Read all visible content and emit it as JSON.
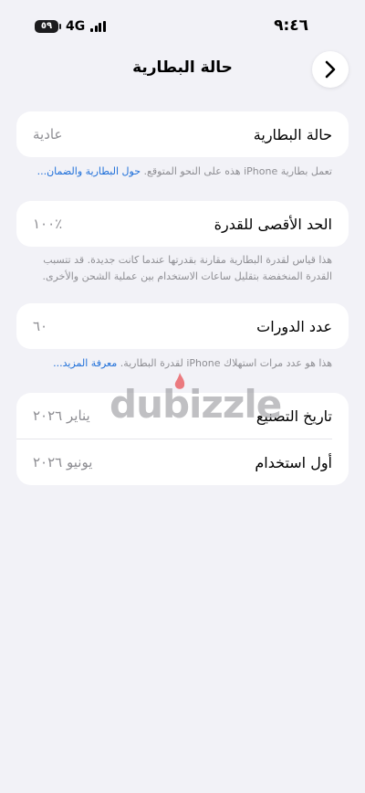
{
  "status": {
    "time": "٩:٤٦",
    "battery": "٥٩",
    "network": "4G"
  },
  "nav": {
    "title": "حالة البطارية",
    "back_icon": "chevron-right-icon"
  },
  "battery_health": {
    "label": "حالة البطارية",
    "value": "عادية",
    "footer_text": "تعمل بطارية iPhone هذه على النحو المتوقع. ",
    "footer_link": "حول البطارية والضمان..."
  },
  "max_capacity": {
    "label": "الحد الأقصى للقدرة",
    "value": "٪١٠٠",
    "footer_text": "هذا قياس لقدرة البطارية مقارنة بقدرتها عندما كانت جديدة. قد تتسبب القدرة المنخفضة بتقليل ساعات الاستخدام بين عملية الشحن والأخرى."
  },
  "cycle_count": {
    "label": "عدد الدورات",
    "value": "٦٠",
    "footer_text": "هذا هو عدد مرات استهلاك iPhone لقدرة البطارية. ",
    "footer_link": "معرفة المزيد..."
  },
  "dates": {
    "manufacture_label": "تاريخ التصنيع",
    "manufacture_value": "يناير ٢٠٢٦",
    "first_use_label": "أول استخدام",
    "first_use_value": "يونيو ٢٠٢٦"
  },
  "watermark": "dubizzle",
  "colors": {
    "background": "#f2f2f7",
    "card": "#ffffff",
    "link": "#1e6fd9",
    "secondary_text": "#8e8e93"
  }
}
